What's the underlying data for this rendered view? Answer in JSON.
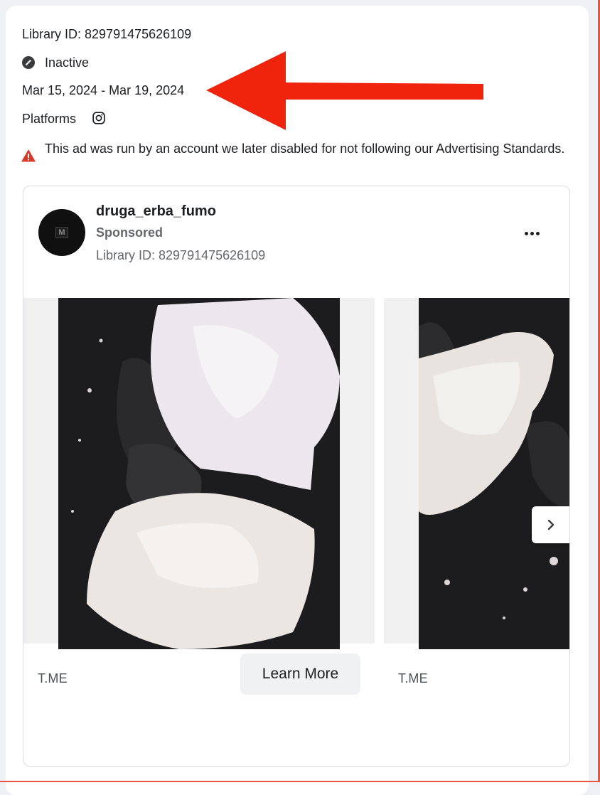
{
  "ad": {
    "library_id_label": "Library ID: 829791475626109",
    "status": "Inactive",
    "date_range": "Mar 15, 2024 - Mar 19, 2024",
    "platforms_label": "Platforms",
    "platform_icons": [
      "instagram-icon"
    ],
    "warning_text": "This ad was run by an account we later disabled for not following our Advertising Standards.",
    "colors": {
      "warning": "#d93a2a",
      "annotation_arrow": "#f0230c",
      "status_icon": "#3a3b3d"
    }
  },
  "preview": {
    "avatar_text": "M",
    "advertiser_name": "druga_erba_fumo",
    "sponsored_label": "Sponsored",
    "library_id_label": "Library ID: 829791475626109",
    "more_icon": "more-horizontal-icon",
    "cards": [
      {
        "domain": "T.ME",
        "cta": "Learn More"
      },
      {
        "domain": "T.ME"
      }
    ],
    "next_icon": "chevron-right-icon"
  }
}
